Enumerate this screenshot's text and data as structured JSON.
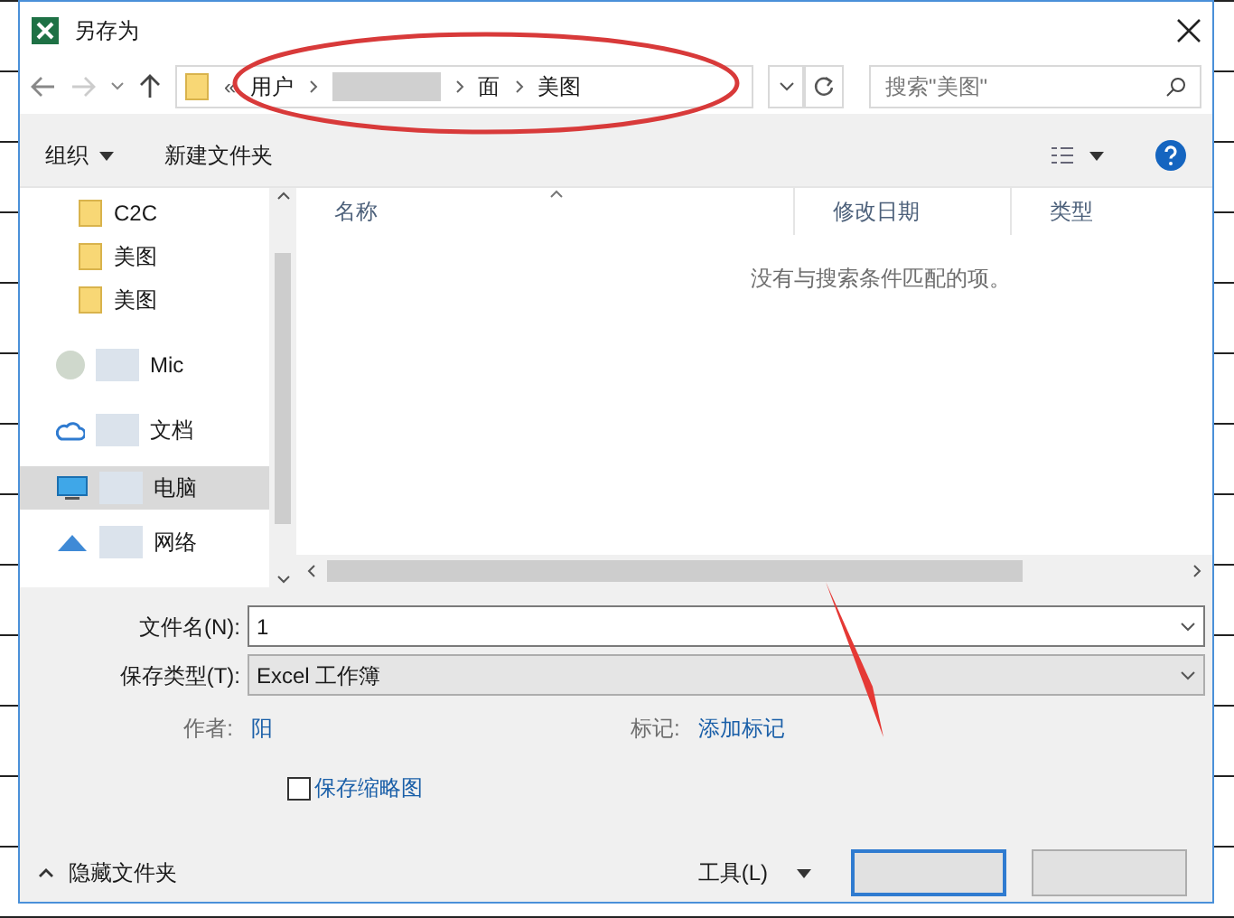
{
  "window": {
    "title": "另存为"
  },
  "address": {
    "crumb_prefix": "«",
    "crumbs": [
      {
        "label": "用户",
        "redacted": false
      },
      {
        "redacted": true
      },
      {
        "label": "面",
        "redacted": false
      },
      {
        "label": "美图",
        "redacted": false
      }
    ]
  },
  "search": {
    "placeholder": "搜索\"美图\""
  },
  "toolbar": {
    "organize": "组织",
    "new_folder": "新建文件夹"
  },
  "nav_items": [
    {
      "label": "C2C",
      "kind": "folder",
      "selected": false
    },
    {
      "label": "美图",
      "kind": "folder",
      "selected": false
    },
    {
      "label": "美图",
      "kind": "folder",
      "selected": false
    },
    {
      "label": "Mic",
      "kind": "blurred",
      "selected": false
    },
    {
      "label": "文档",
      "kind": "cloud",
      "selected": false
    },
    {
      "label": "电脑",
      "kind": "pc",
      "selected": true
    },
    {
      "label": "网络",
      "kind": "network",
      "selected": false
    }
  ],
  "columns": [
    "名称",
    "修改日期",
    "类型"
  ],
  "empty_message": "没有与搜索条件匹配的项。",
  "filename": {
    "label": "文件名(N):",
    "value": "1"
  },
  "filetype": {
    "label": "保存类型(T):",
    "value": "Excel 工作簿"
  },
  "author": {
    "label": "作者:",
    "value": "阳"
  },
  "tags": {
    "label": "标记:",
    "value": "添加标记"
  },
  "thumbnail": {
    "label": "保存缩略图",
    "checked": false
  },
  "hide_folders": "隐藏文件夹",
  "tools": "工具(L)"
}
